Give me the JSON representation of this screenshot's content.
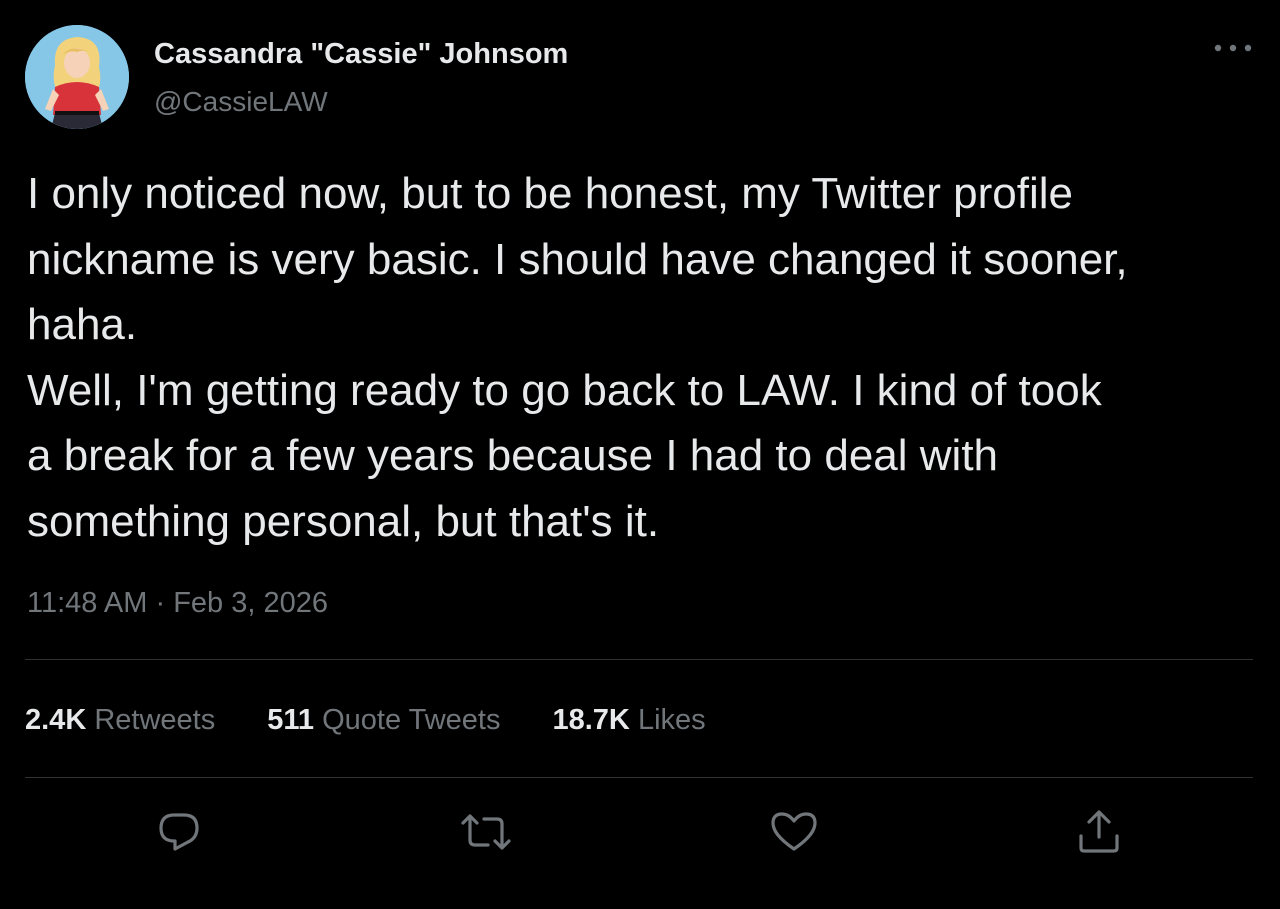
{
  "tweet": {
    "author": {
      "display_name": "Cassandra \"Cassie\" Johnsom",
      "handle": "@CassieLAW"
    },
    "text": "I only noticed now, but to be honest, my Twitter profile\nnickname is very basic. I should have changed it sooner,\nhaha.\nWell, I'm getting ready to go back to LAW. I kind of took\na break for a few years because I had to deal with\nsomething personal, but that's it.",
    "time": "11:48 AM",
    "separator": "·",
    "date": "Feb 3, 2026",
    "stats": {
      "retweets_count": "2.4K",
      "retweets_label": "Retweets",
      "quotes_count": "511",
      "quotes_label": "Quote Tweets",
      "likes_count": "18.7K",
      "likes_label": "Likes"
    }
  },
  "icons": [
    "more-options-icon",
    "reply-icon",
    "retweet-icon",
    "like-icon",
    "share-icon"
  ],
  "colors": {
    "background": "#000000",
    "primary_text": "#e7e9ea",
    "secondary_text": "#71767b",
    "divider": "#2f3336"
  }
}
